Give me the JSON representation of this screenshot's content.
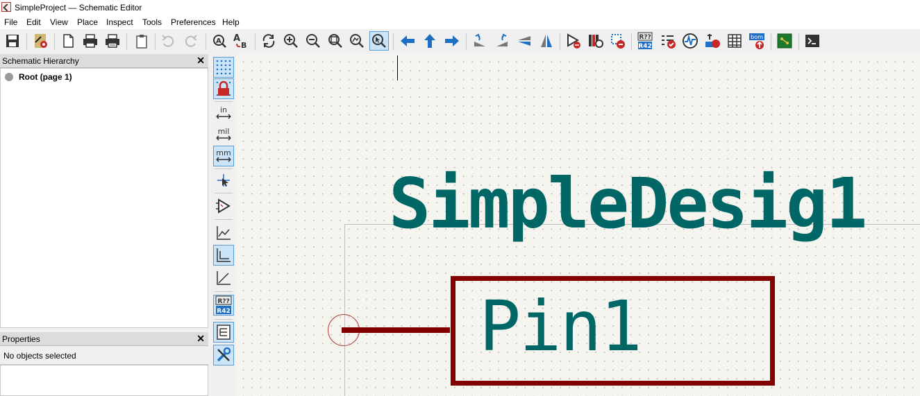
{
  "window": {
    "title": "SimpleProject — Schematic Editor"
  },
  "menu": [
    "File",
    "Edit",
    "View",
    "Place",
    "Inspect",
    "Tools",
    "Preferences",
    "Help"
  ],
  "toolbar": {
    "buttons": [
      "save-icon",
      "schematic-setup-icon",
      "page-settings-icon",
      "print-icon",
      "plot-icon",
      "paste-icon",
      "undo-icon",
      "redo-icon",
      "find-icon",
      "find-replace-icon",
      "refresh-icon",
      "zoom-in-icon",
      "zoom-out-icon",
      "zoom-fit-icon",
      "zoom-objects-icon",
      "zoom-selection-icon",
      "navigate-back-icon",
      "navigate-up-icon",
      "navigate-forward-icon",
      "rotate-ccw-icon",
      "rotate-cw-icon",
      "mirror-vertical-icon",
      "mirror-horizontal-icon",
      "symbol-editor-icon",
      "symbol-library-browser-icon",
      "update-pcb-icon",
      "annotate-icon",
      "erc-icon",
      "simulator-icon",
      "footprint-assign-icon",
      "bom-icon",
      "bom-export-icon",
      "pcb-editor-icon",
      "scripting-console-icon"
    ],
    "bom_badge": "bom",
    "annotate_badge": [
      "R??",
      "R42"
    ]
  },
  "hierarchy": {
    "title": "Schematic Hierarchy",
    "root_label": "Root (page 1)"
  },
  "properties": {
    "title": "Properties",
    "empty_text": "No objects selected"
  },
  "left_toolbar": {
    "units": {
      "in": "in",
      "mil": "mil",
      "mm": "mm"
    },
    "annotate_top": "R??",
    "annotate_bottom": "R42"
  },
  "canvas": {
    "sheet_name": "SimpleDesig1",
    "pin_label": "Pin1",
    "colors": {
      "text": "#006666",
      "body": "#840000",
      "pin_circle": "#b04040",
      "background": "#f5f4ef",
      "sheet_border": "#bcbcbc"
    }
  }
}
